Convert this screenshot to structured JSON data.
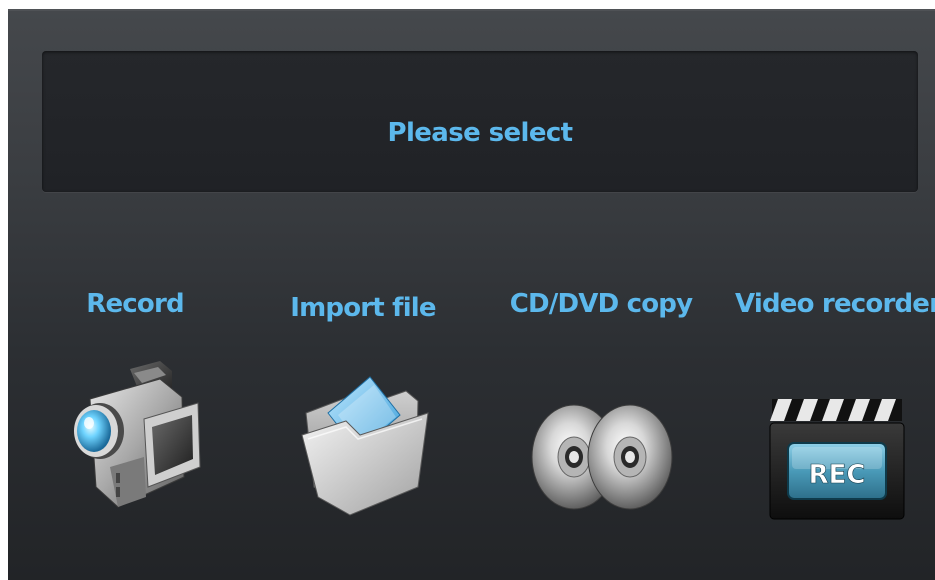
{
  "banner": {
    "title": "Please select"
  },
  "options": [
    {
      "label": "Record",
      "icon": "video-camera-icon"
    },
    {
      "label": "Import file",
      "icon": "folder-icon"
    },
    {
      "label": "CD/DVD copy",
      "icon": "discs-icon"
    },
    {
      "label": "Video recorder",
      "icon": "clapperboard-rec-icon"
    }
  ],
  "rec_badge": "REC",
  "colors": {
    "accent": "#5cb8ec",
    "panel_top": "#45484c",
    "panel_bottom": "#222427",
    "banner": "#222428"
  }
}
